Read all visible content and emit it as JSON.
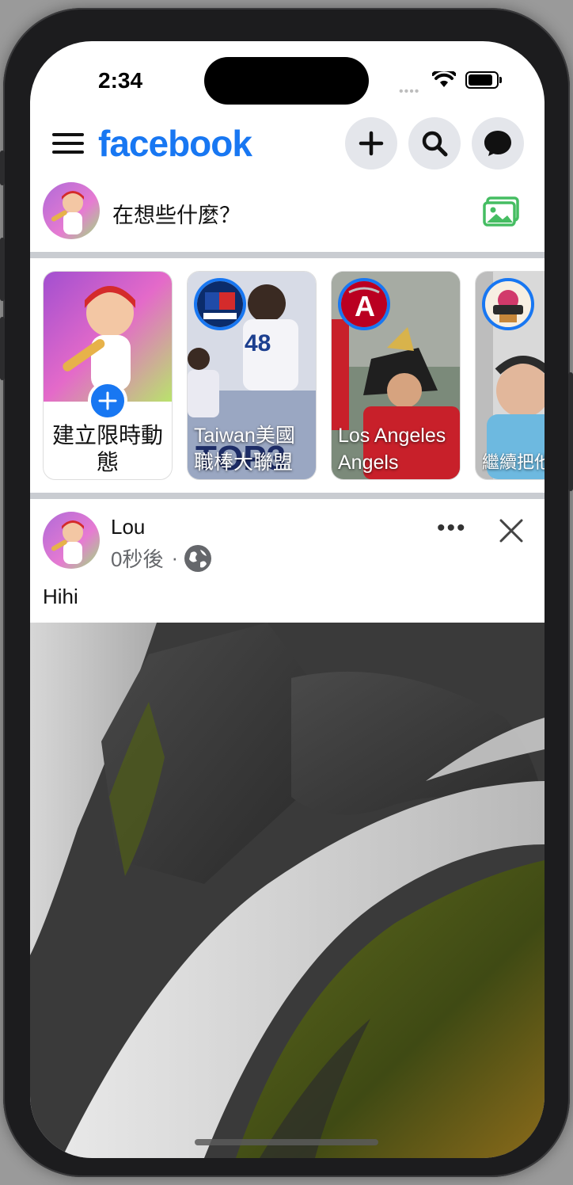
{
  "status_bar": {
    "time": "2:34"
  },
  "header": {
    "logo": "facebook",
    "icons": [
      "menu-icon",
      "plus-icon",
      "search-icon",
      "messenger-icon"
    ]
  },
  "composer": {
    "prompt": "在想些什麼？",
    "icon": "photo-icon"
  },
  "stories": [
    {
      "kind": "create",
      "label": "建立限時動態"
    },
    {
      "kind": "page",
      "label": "Taiwan美國職棒大聯盟"
    },
    {
      "kind": "page",
      "label": "Los Angeles Angels"
    },
    {
      "kind": "page",
      "label": "繼續把他放台南"
    }
  ],
  "post": {
    "author": "Lou",
    "time": "0秒後",
    "separator": "·",
    "text": "Hihi"
  },
  "colors": {
    "brand": "#1877f2",
    "secondary_text": "#65676b",
    "divider": "#c9ccd1"
  }
}
